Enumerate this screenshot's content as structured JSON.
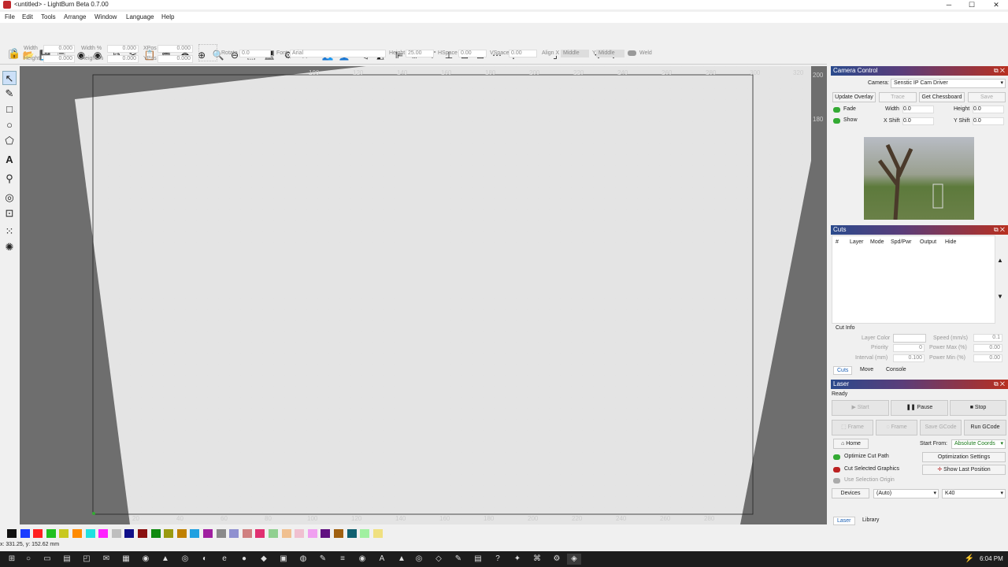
{
  "window": {
    "title": "<untitled> - LightBurn Beta 0.7.00",
    "min": "─",
    "max": "☐",
    "close": "✕"
  },
  "menu": [
    "File",
    "Edit",
    "Tools",
    "Arrange",
    "Window",
    "Language",
    "Help"
  ],
  "props": {
    "width_label": "Width",
    "width_val": "0.000",
    "height_label": "Height",
    "height_val": "0.000",
    "widthpct_label": "Width %",
    "widthpct_val": "0.000",
    "heightpct_label": "Height %",
    "heightpct_val": "0.000",
    "xpos_label": "XPos",
    "xpos_val": "0.000",
    "ypos_label": "YPos",
    "ypos_val": "0.000",
    "rotate_label": "Rotate",
    "rotate_val": "0.0",
    "font_label": "Font",
    "font_val": "Arial",
    "fheight_label": "Height",
    "fheight_val": "25.00",
    "hspace_label": "HSpace",
    "hspace_val": "0.00",
    "vspace_label": "VSpace",
    "vspace_val": "0.00",
    "alignx_label": "Align X",
    "alignx_val": "Middle",
    "aligny_label": "Y",
    "aligny_val": "Middle",
    "weld_label": "Weld"
  },
  "ruler": {
    "top": [
      "100",
      "120",
      "140",
      "160",
      "180",
      "200",
      "220",
      "240",
      "260",
      "280",
      "300",
      "320"
    ],
    "right": [
      "200",
      "180"
    ],
    "bottom": [
      "20",
      "40",
      "60",
      "80",
      "100",
      "120",
      "140",
      "160",
      "180",
      "200",
      "220",
      "240",
      "260",
      "280"
    ]
  },
  "camera": {
    "title": "Camera Control",
    "camera_label": "Camera:",
    "camera_val": "Senstic IP Cam Driver",
    "update": "Update Overlay",
    "trace": "Trace",
    "chess": "Get Chessboard",
    "save": "Save",
    "fade": "Fade",
    "show": "Show",
    "width_label": "Width",
    "width_val": "0.0",
    "height_label": "Height",
    "height_val": "0.0",
    "xshift_label": "X Shift",
    "xshift_val": "0.0",
    "yshift_label": "Y Shift",
    "yshift_val": "0.0"
  },
  "cuts": {
    "title": "Cuts",
    "cols": [
      "#",
      "Layer",
      "Mode",
      "Spd/Pwr",
      "Output",
      "Hide"
    ],
    "info": "Cut Info",
    "layer_color": "Layer Color",
    "priority": "Priority",
    "priority_val": "0",
    "interval": "Interval (mm)",
    "interval_val": "0.100",
    "speed": "Speed (mm/s)",
    "speed_val": "0.1",
    "pmax": "Power Max (%)",
    "pmax_val": "0.00",
    "pmin": "Power Min (%)",
    "pmin_val": "0.00",
    "tabs": [
      "Cuts",
      "Move",
      "Console"
    ]
  },
  "laser": {
    "title": "Laser",
    "status": "Ready",
    "start": "Start",
    "pause": "Pause",
    "stop": "Stop",
    "frame1": "Frame",
    "frame2": "Frame",
    "savegc": "Save GCode",
    "rungc": "Run GCode",
    "home": "Home",
    "startfrom": "Start From:",
    "startfrom_val": "Absolute Coords",
    "optcut": "Optimize Cut Path",
    "optset": "Optimization Settings",
    "cutsel": "Cut Selected Graphics",
    "showlast": "Show Last Position",
    "usesel": "Use Selection Origin",
    "devices": "Devices",
    "port": "(Auto)",
    "machine": "K40",
    "tabs": [
      "Laser",
      "Library"
    ]
  },
  "status": "x: 331.25, y: 152.62 mm",
  "clock": "6:04 PM",
  "colors": [
    "#111111",
    "#1a3cff",
    "#ff2020",
    "#20c020",
    "#c8c820",
    "#ff8a00",
    "#20e0e0",
    "#ff20ff",
    "#bfbfbf",
    "#10108a",
    "#8a1010",
    "#108a10",
    "#9a9a10",
    "#c08000",
    "#20a0e0",
    "#a020a0",
    "#8a8a8a",
    "#8f90d0",
    "#d08080",
    "#e03070",
    "#90d090",
    "#f0c090",
    "#f0c0d0",
    "#f0a0f0",
    "#601080",
    "#a06010",
    "#106070",
    "#a0f0a0",
    "#f0e080"
  ]
}
